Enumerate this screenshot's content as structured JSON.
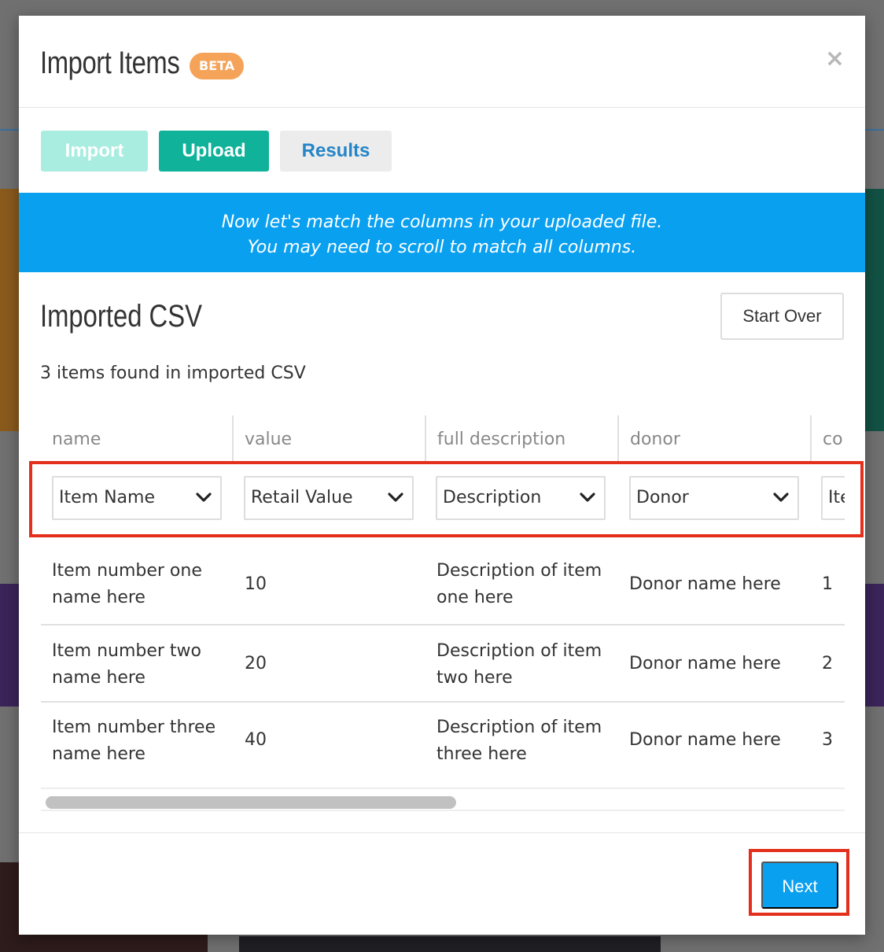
{
  "modal": {
    "title": "Import Items",
    "badge": "BETA",
    "close_glyph": "×"
  },
  "tabs": [
    {
      "label": "Import"
    },
    {
      "label": "Upload"
    },
    {
      "label": "Results"
    }
  ],
  "banner": {
    "line1": "Now let's match the columns in your uploaded file.",
    "line2": "You may need to scroll to match all columns."
  },
  "section": {
    "title": "Imported CSV",
    "start_over_label": "Start Over",
    "count_text": "3 items found in imported CSV"
  },
  "table": {
    "headers": [
      "name",
      "value",
      "full description",
      "donor",
      "co"
    ],
    "mappings": [
      "Item Name",
      "Retail Value",
      "Description",
      "Donor",
      "Ite"
    ],
    "rows": [
      {
        "name": "Item number one name here",
        "value": "10",
        "description": "Description of item one here",
        "donor": "Donor name here",
        "extra": "1"
      },
      {
        "name": "Item number two name here",
        "value": "20",
        "description": "Description of item two here",
        "donor": "Donor name here",
        "extra": "2"
      },
      {
        "name": "Item number three name here",
        "value": "40",
        "description": "Description of item three here",
        "donor": "Donor name here",
        "extra": "3"
      }
    ]
  },
  "footer": {
    "next_label": "Next"
  },
  "colors": {
    "accent_blue": "#0aa0f0",
    "teal": "#10b39a",
    "beta_orange": "#f6a35a",
    "highlight_red": "#e42f1c"
  },
  "icons": {
    "close": "close-icon",
    "select_arrow": "chevron-down-icon"
  }
}
